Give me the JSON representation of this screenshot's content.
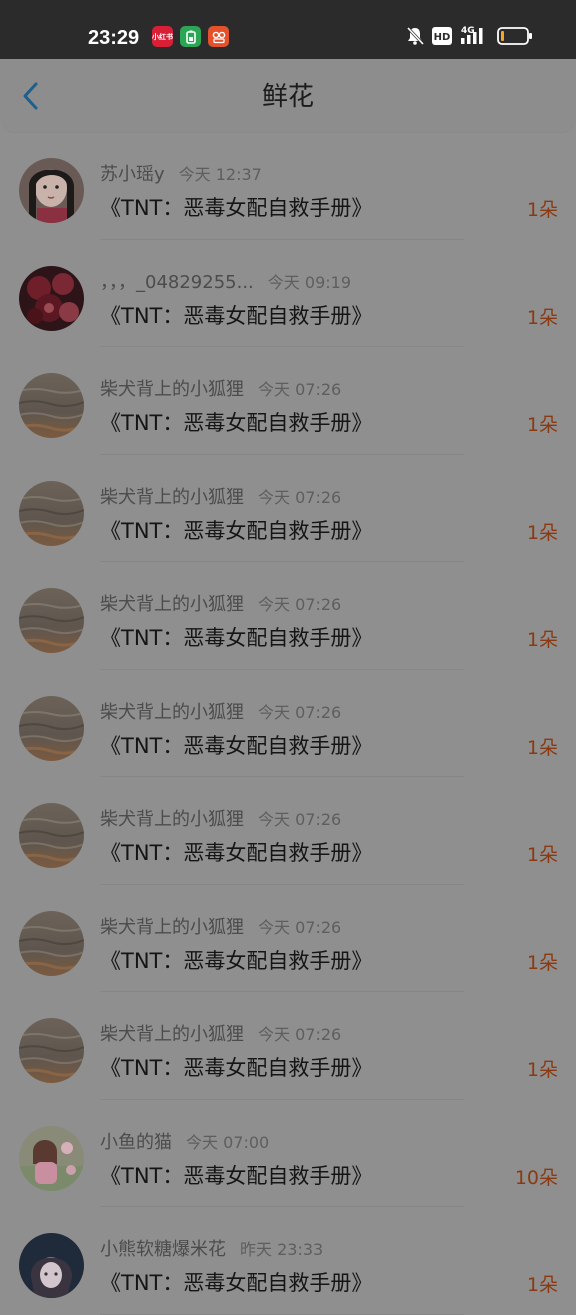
{
  "status_bar": {
    "time": "23:29",
    "network": "4G",
    "hd": "HD",
    "apps": [
      {
        "name": "xiaohongshu-app-icon",
        "color": "#e5203a"
      },
      {
        "name": "battery-saver-app-icon",
        "color": "#2fb558"
      },
      {
        "name": "bilibili-style-app-icon",
        "color": "#e8532e"
      }
    ]
  },
  "header": {
    "title": "鲜花"
  },
  "items": [
    {
      "name": "苏小瑶y",
      "time": "今天 12:37",
      "book": "《TNT：恶毒女配自救手册》",
      "count": "1朵",
      "avatar": "girl-portrait"
    },
    {
      "name": "，，，_04829255...",
      "time": "今天 09:19",
      "book": "《TNT：恶毒女配自救手册》",
      "count": "1朵",
      "avatar": "red-flowers"
    },
    {
      "name": "柴犬背上的小狐狸",
      "time": "今天 07:26",
      "book": "《TNT：恶毒女配自救手册》",
      "count": "1朵",
      "avatar": "ocean"
    },
    {
      "name": "柴犬背上的小狐狸",
      "time": "今天 07:26",
      "book": "《TNT：恶毒女配自救手册》",
      "count": "1朵",
      "avatar": "ocean"
    },
    {
      "name": "柴犬背上的小狐狸",
      "time": "今天 07:26",
      "book": "《TNT：恶毒女配自救手册》",
      "count": "1朵",
      "avatar": "ocean"
    },
    {
      "name": "柴犬背上的小狐狸",
      "time": "今天 07:26",
      "book": "《TNT：恶毒女配自救手册》",
      "count": "1朵",
      "avatar": "ocean"
    },
    {
      "name": "柴犬背上的小狐狸",
      "time": "今天 07:26",
      "book": "《TNT：恶毒女配自救手册》",
      "count": "1朵",
      "avatar": "ocean"
    },
    {
      "name": "柴犬背上的小狐狸",
      "time": "今天 07:26",
      "book": "《TNT：恶毒女配自救手册》",
      "count": "1朵",
      "avatar": "ocean"
    },
    {
      "name": "柴犬背上的小狐狸",
      "time": "今天 07:26",
      "book": "《TNT：恶毒女配自救手册》",
      "count": "1朵",
      "avatar": "ocean"
    },
    {
      "name": "小鱼的猫",
      "time": "今天 07:00",
      "book": "《TNT：恶毒女配自救手册》",
      "count": "10朵",
      "avatar": "pink-girl"
    },
    {
      "name": "小熊软糖爆米花",
      "time": "昨天 23:33",
      "book": "《TNT：恶毒女配自救手册》",
      "count": "1朵",
      "avatar": "dark-girl"
    }
  ]
}
